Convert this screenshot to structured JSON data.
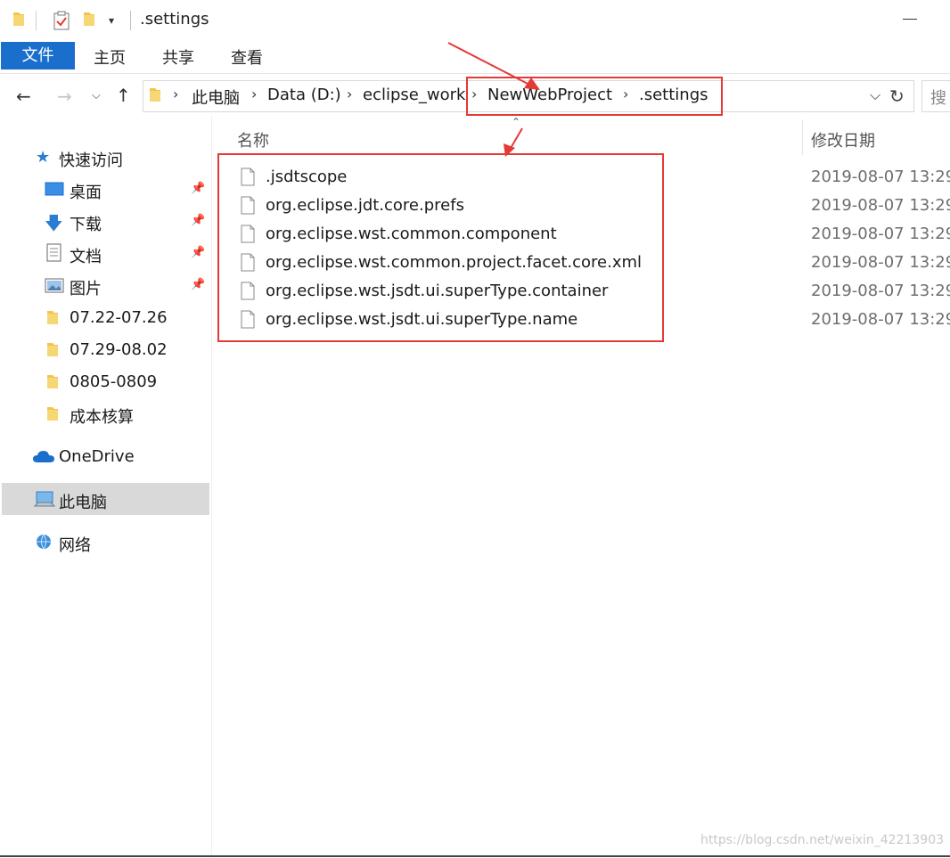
{
  "window": {
    "title": ".settings"
  },
  "ribbon": {
    "file_tab": "文件",
    "tabs": [
      "主页",
      "共享",
      "查看"
    ]
  },
  "address": {
    "crumbs": [
      "此电脑",
      "Data (D:)",
      "eclipse_work",
      "NewWebProject",
      ".settings"
    ],
    "search_placeholder": "搜"
  },
  "nav": {
    "quick_access": "快速访问",
    "quick_items": [
      "桌面",
      "下载",
      "文档",
      "图片",
      "07.22-07.26",
      "07.29-08.02",
      "0805-0809",
      "成本核算"
    ],
    "onedrive": "OneDrive",
    "this_pc": "此电脑",
    "network": "网络"
  },
  "columns": {
    "name": "名称",
    "modified": "修改日期"
  },
  "files": [
    {
      "name": ".jsdtscope",
      "date": "2019-08-07 13:29"
    },
    {
      "name": "org.eclipse.jdt.core.prefs",
      "date": "2019-08-07 13:29"
    },
    {
      "name": "org.eclipse.wst.common.component",
      "date": "2019-08-07 13:29"
    },
    {
      "name": "org.eclipse.wst.common.project.facet.core.xml",
      "date": "2019-08-07 13:29"
    },
    {
      "name": "org.eclipse.wst.jsdt.ui.superType.container",
      "date": "2019-08-07 13:29"
    },
    {
      "name": "org.eclipse.wst.jsdt.ui.superType.name",
      "date": "2019-08-07 13:29"
    }
  ],
  "watermark": "https://blog.csdn.net/weixin_42213903",
  "colors": {
    "accent": "#1a6fcc",
    "annotation": "#e53935",
    "folder": "#f2c34d",
    "selection": "#d9d9d9"
  }
}
